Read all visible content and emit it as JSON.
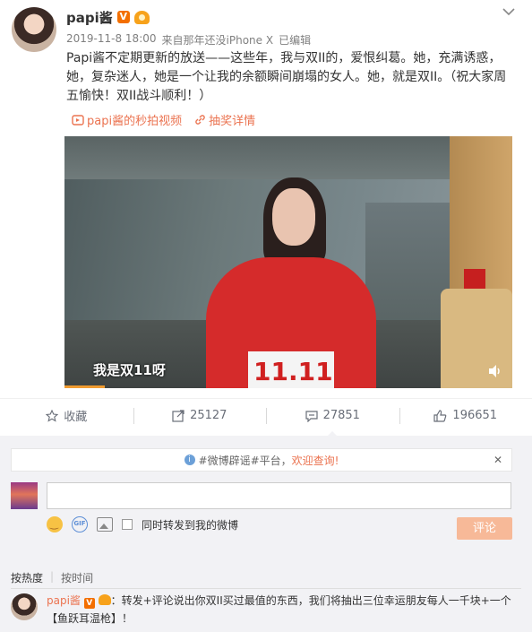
{
  "post": {
    "author": "papi酱",
    "verified_badge": "V",
    "meta": {
      "date": "2019-11-8 18:00",
      "source_prefix": "来自",
      "source": "那年还没iPhone X",
      "edited": "已编辑"
    },
    "text": "Papi酱不定期更新的放送——这些年，我与双II的，爱恨纠葛。她，充满诱惑，她，复杂迷人，她是一个让我的余额瞬间崩塌的女人。她，就是双II。（祝大家周五愉快！双II战斗顺利！）",
    "links": {
      "video": "papi酱的秒拍视频",
      "lottery": "抽奖详情"
    }
  },
  "video": {
    "caption": "我是双11呀",
    "sign_text": "11.11",
    "progress_fraction": 0.09
  },
  "actions": [
    {
      "label": "收藏",
      "icon": "star-icon"
    },
    {
      "label": "25127",
      "icon": "share-icon"
    },
    {
      "label": "27851",
      "icon": "comment-icon"
    },
    {
      "label": "196651",
      "icon": "thumbs-up-icon"
    }
  ],
  "comment_box": {
    "notice_prefix": "#微博辟谣#平台，",
    "notice_link": "欢迎查询!",
    "notice_close": "✕",
    "forward_label": "同时转发到我的微博",
    "submit_label": "评论"
  },
  "sort": {
    "by_hot": "按热度",
    "separator": "|",
    "by_time": "按时间"
  },
  "first_comment": {
    "name": "papi酱",
    "text": "：转发+评论说出你双II买过最值的东西，我们将抽出三位幸运朋友每人一千块+一个【鱼跃耳温枪】！"
  },
  "colors": {
    "accent": "#eb7350",
    "verified": "#f36f00",
    "submit_disabled": "#f7b998"
  }
}
